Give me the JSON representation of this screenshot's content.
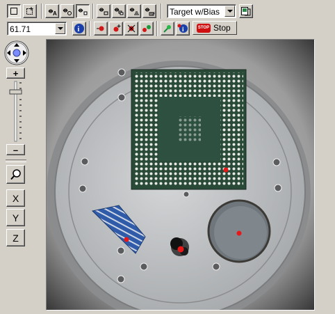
{
  "toolbar": {
    "target_mode": "Target w/Bias",
    "mode_buttons": [
      "select-rect-icon",
      "select-add-icon",
      "pan-a-icon",
      "pan-two-icon",
      "pan-hand-icon",
      "pan-stack-one-icon",
      "pan-stack-two-icon",
      "pan-stack-three-icon",
      "pan-stack-four-icon",
      "image-icon"
    ]
  },
  "toolbar2": {
    "zoom_value": "61.71",
    "stop_label": "Stop",
    "stop_sign_text": "STOP"
  },
  "side": {
    "zoom_in": "+",
    "zoom_out": "–",
    "axis_x": "X",
    "axis_y": "Y",
    "axis_z": "Z"
  },
  "zoom_slider": {
    "level": 0.15
  },
  "colors": {
    "marker": "#e81818",
    "chip_substrate": "#2a4a38",
    "blue_sample": "#2f5ba8",
    "stage": "#b8bbbd"
  }
}
